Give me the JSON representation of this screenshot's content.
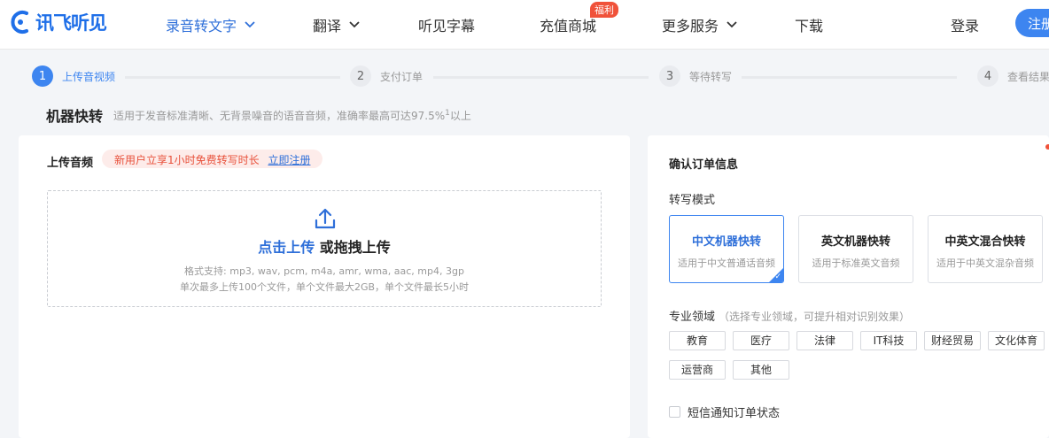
{
  "brand": {
    "name": "讯飞听见",
    "color": "#1f6fe8"
  },
  "nav": {
    "items": [
      {
        "label": "录音转文字",
        "active": true,
        "dropdown": true
      },
      {
        "label": "翻译",
        "active": false,
        "dropdown": true
      },
      {
        "label": "听见字幕",
        "active": false,
        "dropdown": false
      },
      {
        "label": "充值商城",
        "active": false,
        "dropdown": false,
        "badge": "福利"
      },
      {
        "label": "更多服务",
        "active": false,
        "dropdown": true
      },
      {
        "label": "下载",
        "active": false,
        "dropdown": false
      }
    ],
    "login": "登录",
    "register": "注册"
  },
  "steps": [
    {
      "num": "1",
      "label": "上传音视频",
      "active": true
    },
    {
      "num": "2",
      "label": "支付订单",
      "active": false
    },
    {
      "num": "3",
      "label": "等待转写",
      "active": false
    },
    {
      "num": "4",
      "label": "查看结果",
      "active": false
    }
  ],
  "page": {
    "title": "机器快转",
    "subtitle_before": "适用于发音标准清晰、无背景噪音的语音音频，准确率最高可达97.5%",
    "subtitle_sup": "1",
    "subtitle_after": "以上"
  },
  "upload": {
    "title": "上传音频",
    "promo_text": "新用户立享1小时免费转写时长",
    "promo_link": "立即注册",
    "click_text": "点击上传",
    "drag_text": " 或拖拽上传",
    "formats": "格式支持: mp3, wav, pcm, m4a, amr, wma, aac, mp4, 3gp",
    "limits": "单次最多上传100个文件，单个文件最大2GB，单个文件最长5小时"
  },
  "order": {
    "title": "确认订单信息",
    "mode_label": "转写模式",
    "modes": [
      {
        "name": "中文机器快转",
        "desc": "适用于中文普通话音频",
        "selected": true
      },
      {
        "name": "英文机器快转",
        "desc": "适用于标准英文音频",
        "selected": false
      },
      {
        "name": "中英文混合快转",
        "desc": "适用于中英文混杂音频",
        "selected": false
      }
    ],
    "domain_label": "专业领域",
    "domain_hint": "（选择专业领域，可提升相对识别效果）",
    "domains": [
      "教育",
      "医疗",
      "法律",
      "IT科技",
      "财经贸易",
      "文化体育",
      "运营商",
      "其他"
    ],
    "sms_label": "短信通知订单状态"
  },
  "colors": {
    "primary": "#3d85f0",
    "accent_red": "#f0523a"
  }
}
